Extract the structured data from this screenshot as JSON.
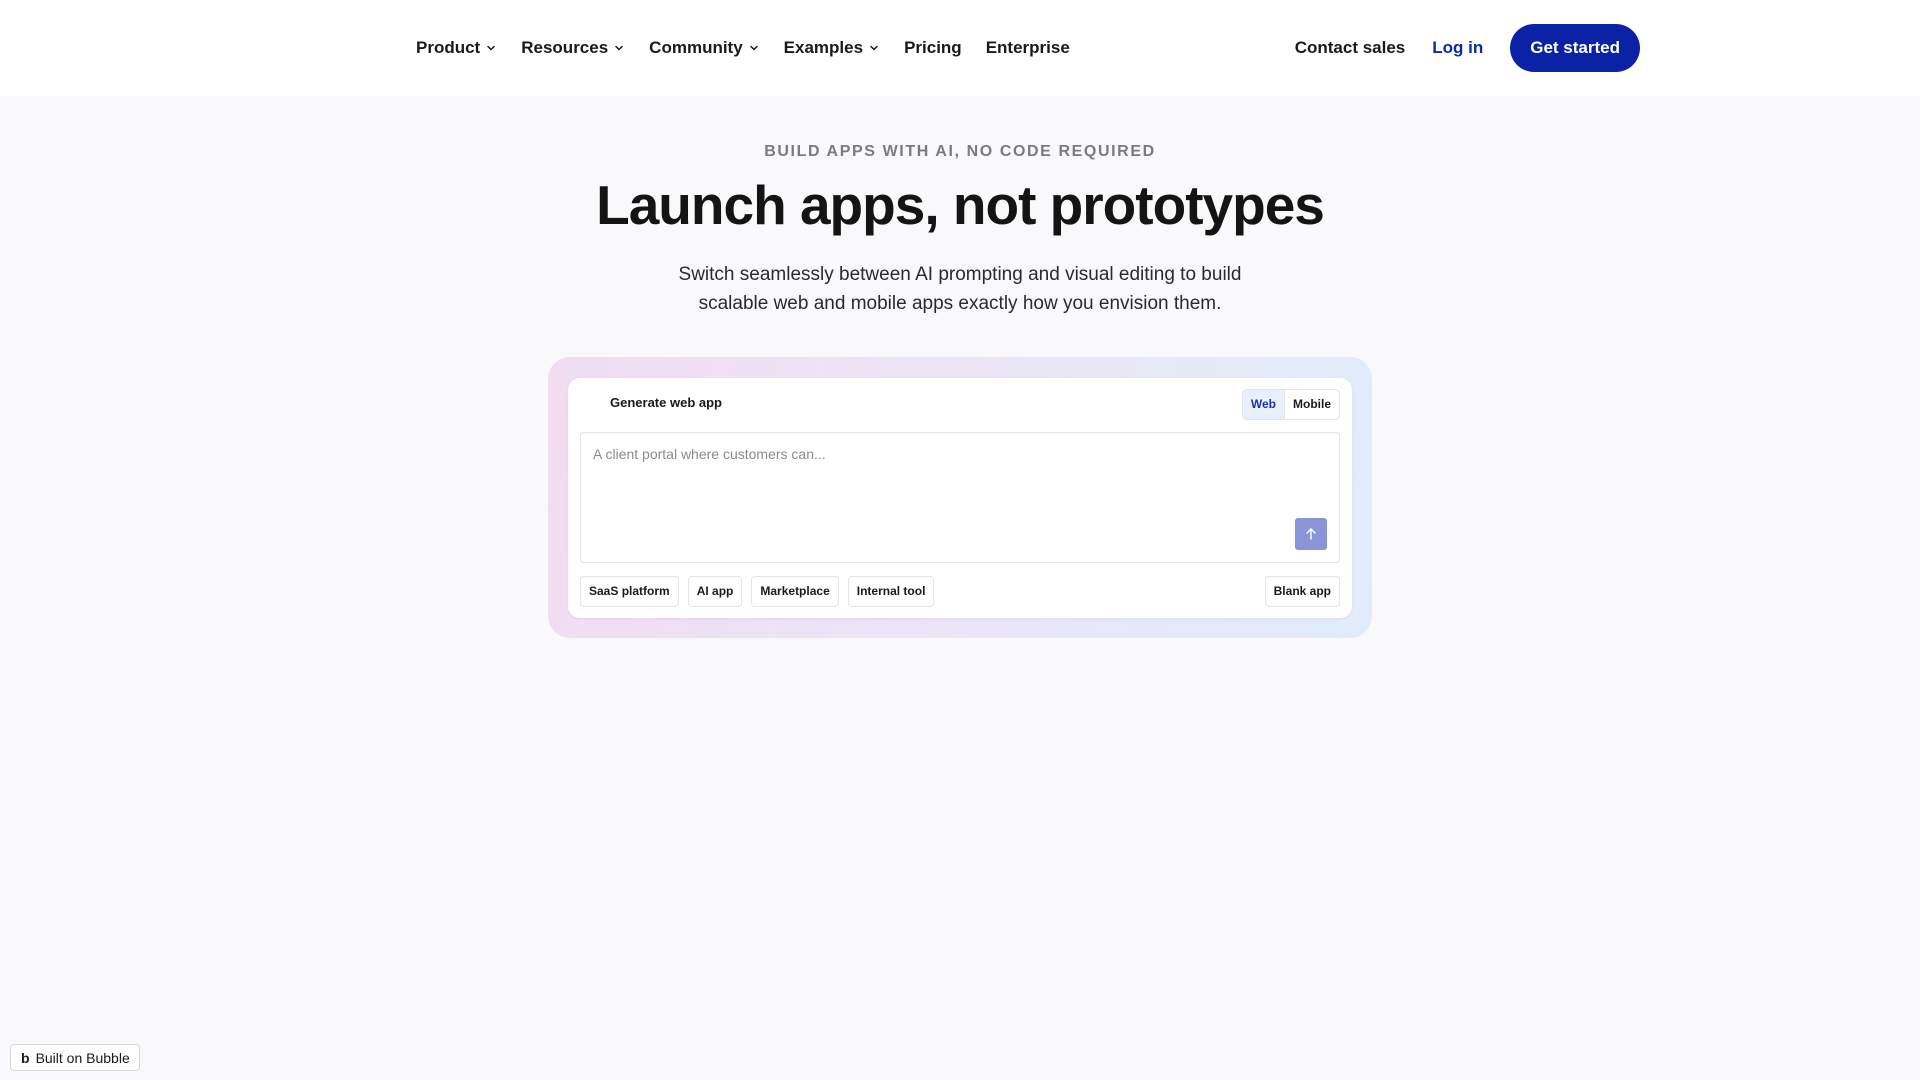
{
  "nav": {
    "items": [
      {
        "label": "Product",
        "has_menu": true
      },
      {
        "label": "Resources",
        "has_menu": true
      },
      {
        "label": "Community",
        "has_menu": true
      },
      {
        "label": "Examples",
        "has_menu": true
      },
      {
        "label": "Pricing",
        "has_menu": false
      },
      {
        "label": "Enterprise",
        "has_menu": false
      }
    ],
    "contact_sales": "Contact sales",
    "log_in": "Log in",
    "get_started": "Get started"
  },
  "hero": {
    "eyebrow": "BUILD APPS WITH AI, NO CODE REQUIRED",
    "title": "Launch apps, not prototypes",
    "subtitle_line1": "Switch seamlessly between AI prompting and visual editing to build",
    "subtitle_line2": "scalable web and mobile apps exactly how you envision them."
  },
  "generator": {
    "title": "Generate web app",
    "toggle": {
      "web": "Web",
      "mobile": "Mobile",
      "selected": "web"
    },
    "prompt": {
      "value": "",
      "placeholder": "A client portal where customers can..."
    },
    "send_icon": "arrow-up-icon",
    "chips": [
      {
        "label": "SaaS platform"
      },
      {
        "label": "AI app"
      },
      {
        "label": "Marketplace"
      },
      {
        "label": "Internal tool"
      }
    ],
    "blank_app": "Blank app"
  },
  "badge": {
    "logo": "b",
    "label": "Built on Bubble"
  },
  "colors": {
    "primary": "#0b22a6",
    "login_link": "#0b2aa8",
    "send_button": "#8a95d8",
    "page_bg": "#f9f9fb"
  }
}
